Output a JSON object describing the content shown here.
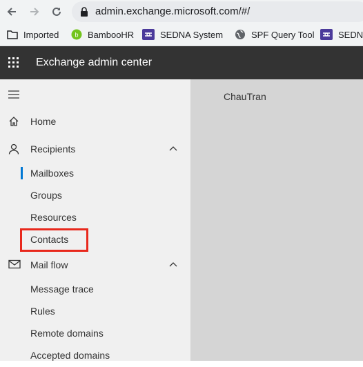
{
  "browser": {
    "url": "admin.exchange.microsoft.com/#/",
    "bookmarks": [
      {
        "label": "Imported",
        "icon": "folder-icon"
      },
      {
        "label": "BambooHR",
        "icon": "bamboohr-icon"
      },
      {
        "label": "SEDNA System",
        "icon": "sedna-icon"
      },
      {
        "label": "SPF Query Tool",
        "icon": "globe-icon"
      },
      {
        "label": "SEDNA",
        "icon": "sedna-icon"
      }
    ]
  },
  "header": {
    "title": "Exchange admin center"
  },
  "sidebar": {
    "items": [
      {
        "label": "Home",
        "icon": "home-icon"
      },
      {
        "label": "Recipients",
        "icon": "person-icon",
        "expanded": true,
        "children": [
          "Mailboxes",
          "Groups",
          "Resources",
          "Contacts"
        ]
      },
      {
        "label": "Mail flow",
        "icon": "mail-icon",
        "expanded": true,
        "children": [
          "Message trace",
          "Rules",
          "Remote domains",
          "Accepted domains"
        ]
      }
    ],
    "active_item": "Mailboxes",
    "highlighted_item": "Contacts"
  },
  "main": {
    "user_name": "ChauTran"
  },
  "colors": {
    "header_bg": "#333333",
    "accent": "#0078d4",
    "highlight_border": "#e8281c"
  }
}
